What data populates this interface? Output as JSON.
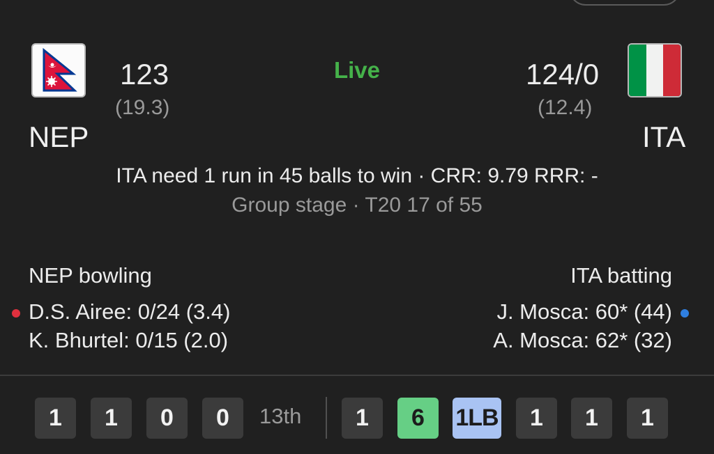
{
  "match": {
    "status": "Live",
    "summary": "ITA need 1 run in 45 balls to win · CRR: 9.79 RRR: -",
    "stage": "Group stage · T20 17 of 55"
  },
  "home": {
    "code": "NEP",
    "score": "123",
    "overs": "(19.3)",
    "flag_colors": {
      "border": "#003893",
      "fill": "#DC143C",
      "emblem": "#ffffff"
    }
  },
  "away": {
    "code": "ITA",
    "score": "124/0",
    "overs": "(12.4)",
    "flag_colors": {
      "left": "#009246",
      "center": "#f1f2f1",
      "right": "#CE2B37"
    }
  },
  "bowling": {
    "title": "NEP bowling",
    "players": [
      {
        "text": "D.S. Airee: 0/24 (3.4)",
        "active": true
      },
      {
        "text": "K. Bhurtel: 0/15 (2.0)",
        "active": false
      }
    ],
    "indicator_color": "#e0303e"
  },
  "batting": {
    "title": "ITA batting",
    "players": [
      {
        "text": "J. Mosca: 60* (44)",
        "active": true
      },
      {
        "text": "A. Mosca: 62* (32)",
        "active": false
      }
    ],
    "indicator_color": "#2f7fe0"
  },
  "balls": {
    "previous_over": [
      "1",
      "1",
      "0",
      "0"
    ],
    "over_label": "13th",
    "current_over": [
      {
        "value": "1",
        "type": "run"
      },
      {
        "value": "6",
        "type": "six"
      },
      {
        "value": "1LB",
        "type": "legbye"
      },
      {
        "value": "1",
        "type": "run"
      },
      {
        "value": "1",
        "type": "run"
      },
      {
        "value": "1",
        "type": "run"
      }
    ],
    "colors": {
      "run": "#3b3b3b",
      "six": "#66cf85",
      "legbye": "#a9c3f3"
    }
  }
}
